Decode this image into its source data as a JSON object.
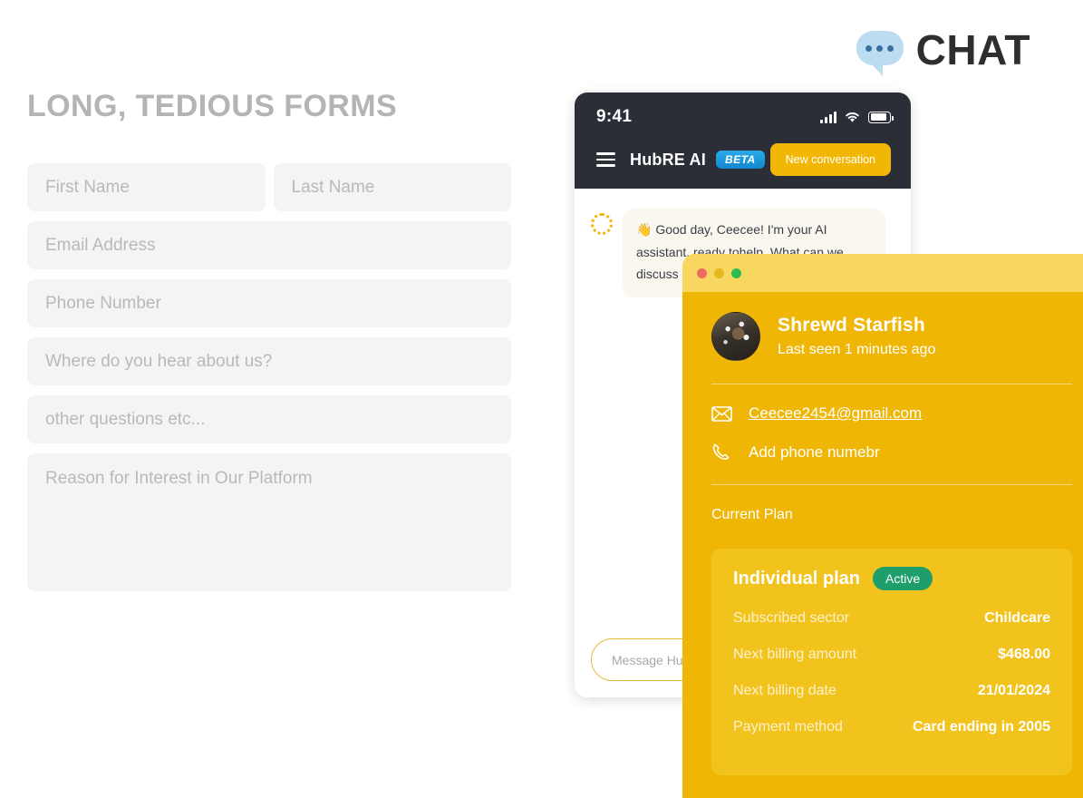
{
  "logo": {
    "word": "CHAT",
    "icon": "chat-bubble-icon"
  },
  "form": {
    "title": "LONG, TEDIOUS FORMS",
    "fields": [
      {
        "name": "first-name",
        "placeholder": "First Name",
        "value": ""
      },
      {
        "name": "last-name",
        "placeholder": "Last Name",
        "value": ""
      },
      {
        "name": "email-address",
        "placeholder": "Email Address",
        "value": ""
      },
      {
        "name": "phone-number",
        "placeholder": "Phone Number",
        "value": ""
      },
      {
        "name": "referral-source",
        "placeholder": "Where do you hear about us?",
        "value": ""
      },
      {
        "name": "other-questions",
        "placeholder": "other questions etc...",
        "value": ""
      },
      {
        "name": "reason-for-interest",
        "placeholder": "Reason for Interest in Our Platform",
        "value": ""
      }
    ]
  },
  "phone": {
    "status_bar": {
      "time": "9:41",
      "icons": [
        "cellular-signal-icon",
        "wifi-icon",
        "battery-icon"
      ]
    },
    "app_bar": {
      "menu_icon": "hamburger-menu-icon",
      "app_name": "HubRE AI",
      "badge": "BETA",
      "new_conversation_label": "New conversation"
    },
    "chat": {
      "bot_avatar": "loading-spinner-icon",
      "message": "👋 Good day, Ceecee! I'm your AI assistant, ready tohelp. What can we discuss today?"
    },
    "composer": {
      "placeholder": "Message Hub",
      "value": ""
    }
  },
  "profile_card": {
    "window_dots": [
      "close-dot",
      "minimize-dot",
      "maximize-dot"
    ],
    "name": "Shrewd Starfish",
    "last_seen": "Last seen 1 minutes ago",
    "email": "Ceecee2454@gmail.com",
    "phone_action": "Add phone numebr",
    "current_plan_label": "Current Plan",
    "plan": {
      "name": "Individual plan",
      "status": "Active",
      "rows": [
        {
          "key": "Subscribed sector",
          "value": "Childcare"
        },
        {
          "key": "Next billing amount",
          "value": "$468.00"
        },
        {
          "key": "Next billing date",
          "value": "21/01/2024"
        },
        {
          "key": "Payment method",
          "value": "Card ending in 2005"
        }
      ]
    }
  },
  "colors": {
    "brand_yellow": "#EFB606",
    "card_yellow": "#F2C31C",
    "titlebar_yellow": "#F7D75F",
    "button_yellow": "#F2B705",
    "beta_blue": "#29ABE8",
    "active_green": "#1E9E6A",
    "phone_dark": "#2B2D37",
    "form_grey": "#F4F4F4",
    "placeholder_grey": "#B9B9B9"
  }
}
